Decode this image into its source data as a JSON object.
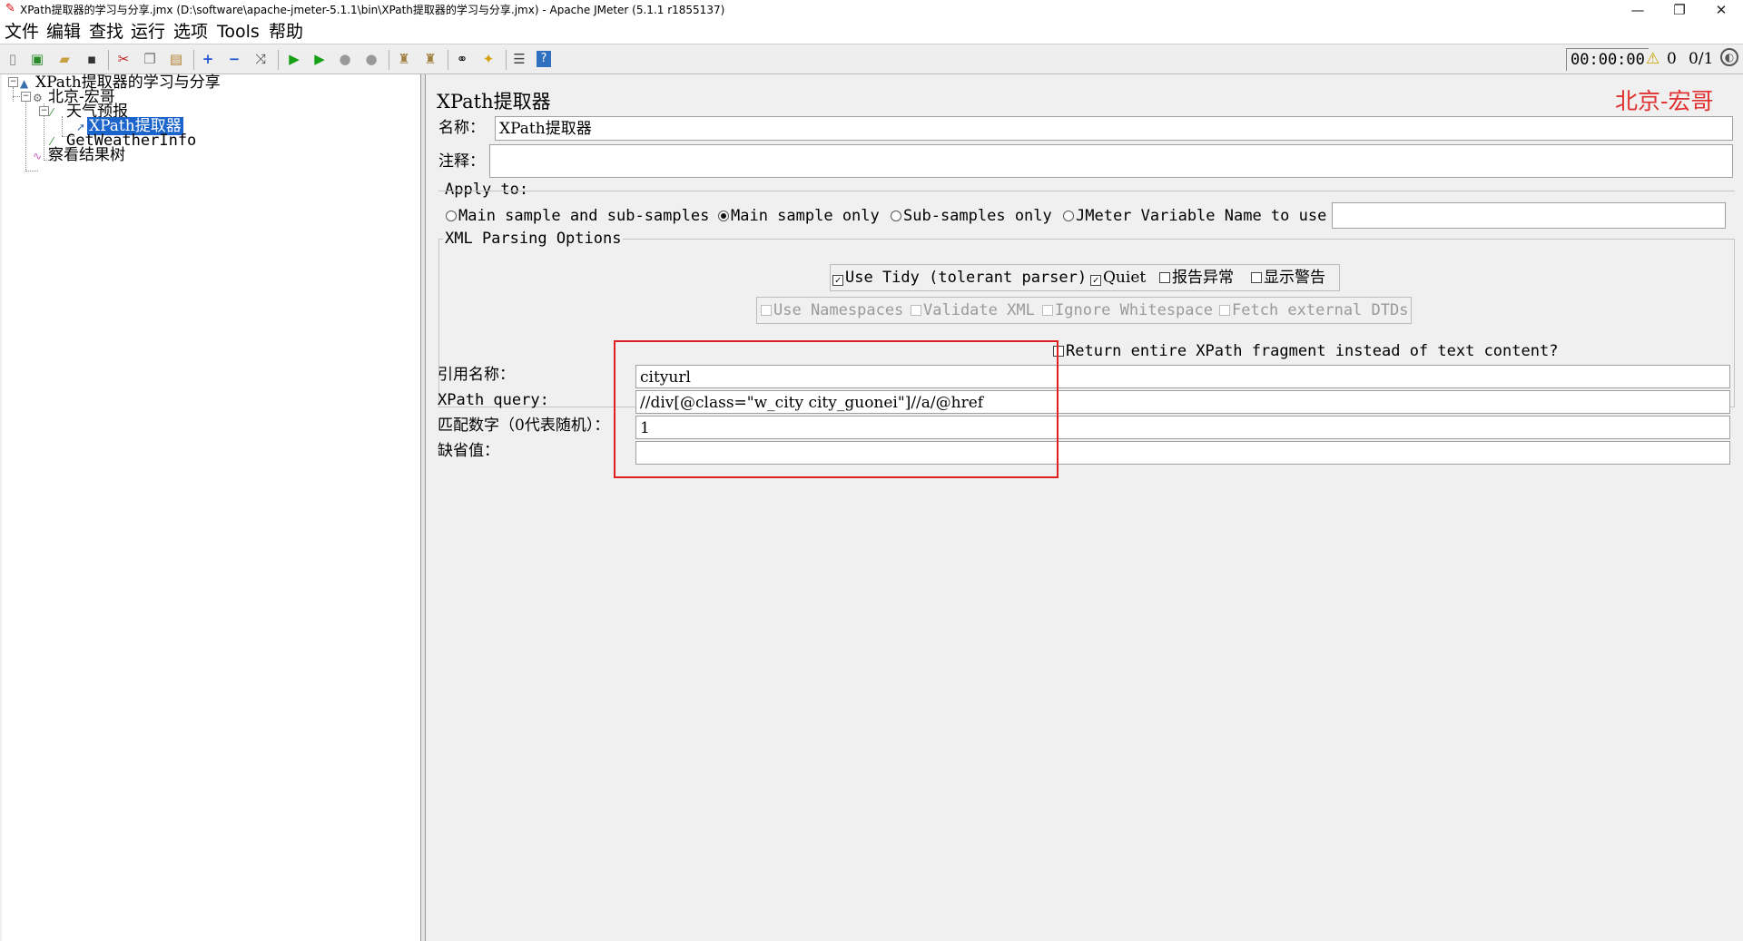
{
  "window": {
    "title": "XPath提取器的学习与分享.jmx (D:\\software\\apache-jmeter-5.1.1\\bin\\XPath提取器的学习与分享.jmx) - Apache JMeter (5.1.1 r1855137)",
    "minimize": "—",
    "restore": "❐",
    "close": "✕"
  },
  "menu": [
    "文件",
    "编辑",
    "查找",
    "运行",
    "选项",
    "Tools",
    "帮助"
  ],
  "toolbar": {
    "timer": "00:00:00",
    "warning_count": "0",
    "thread_count": "0/1"
  },
  "tree": {
    "root": "XPath提取器的学习与分享",
    "thread_group": "北京-宏哥",
    "sampler": "天气预报",
    "extractor": "XPath提取器",
    "sampler2": "GetWeatherInfo",
    "listener": "察看结果树"
  },
  "panel": {
    "title": "XPath提取器",
    "watermark": "北京-宏哥",
    "name_label": "名称：",
    "name_value": "XPath提取器",
    "comment_label": "注释：",
    "comment_value": "",
    "apply_to": {
      "title": "Apply to:",
      "options": [
        "Main sample and sub-samples",
        "Main sample only",
        "Sub-samples only",
        "JMeter Variable Name to use"
      ],
      "selected": 1,
      "variable_value": ""
    },
    "xml_options": {
      "title": "XML Parsing Options",
      "use_tidy": "Use Tidy (tolerant parser)",
      "quiet": "Quiet",
      "report_errors": "报告异常",
      "show_warnings": "显示警告",
      "use_namespaces": "Use Namespaces",
      "validate_xml": "Validate XML",
      "ignore_whitespace": "Ignore Whitespace",
      "fetch_dtds": "Fetch external DTDs",
      "use_tidy_checked": true,
      "quiet_checked": true
    },
    "return_fragment": "Return entire XPath fragment instead of text content?",
    "ref_name_label": "引用名称：",
    "ref_name_value": "cityurl",
    "xpath_label": "XPath query:",
    "xpath_value": "//div[@class=\"w_city city_guonei\"]//a/@href",
    "match_label": "匹配数字（0代表随机）：",
    "match_value": "1",
    "default_label": "缺省值：",
    "default_value": ""
  },
  "colors": {
    "selection": "#1a64cc",
    "watermark": "#e03030",
    "highlight_box": "#e02020"
  }
}
